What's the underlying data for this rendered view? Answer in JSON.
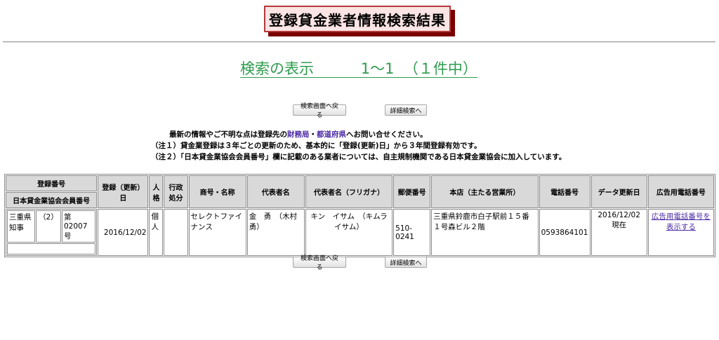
{
  "page": {
    "title": "登録貸金業者情報検索結果",
    "search_label": "検索の表示",
    "search_range": "1～1",
    "search_total": "（１件中）"
  },
  "buttons": {
    "back": "検索画面へ戻る",
    "detail": "詳細検索へ"
  },
  "notes": {
    "line1_prefix": "最新の情報やご不明な点は登録先の",
    "link1": "財務局",
    "sep": "・",
    "link2": "都道府県",
    "line1_suffix": "へお問い合せください。",
    "line2": "（注１）貸金業登録は３年ごとの更新のため、基本的に「登録(更新)日」から３年間登録有効です。",
    "line3": "（注２）「日本貸金業協会会員番号」欄に記載のある業者については、自主規制機関である日本貸金業協会に加入しています。"
  },
  "table": {
    "headers": {
      "reg_no": "登録番号",
      "assoc_no": "日本貸金業協会会員番号",
      "reg_date": "登録（更新）日",
      "person": "人格",
      "admin": "行政処分",
      "trade_name": "商号・名称",
      "rep": "代表者名",
      "rep_kana": "代表者名（フリガナ）",
      "postal": "郵便番号",
      "head_office": "本店（主たる営業所）",
      "phone": "電話番号",
      "updated": "データ更新日",
      "ad_phone": "広告用電話番号"
    },
    "row": {
      "authority": "三重県知事",
      "renewal": "（2）",
      "number": "第02007号",
      "assoc_no": "",
      "reg_date": "2016/12/02",
      "person": "個人",
      "admin": "",
      "trade_name": "セレクトファイナンス",
      "rep": "金　勇　（木村勇）",
      "rep_kana": "キン　イサム　（キムライサム）",
      "postal": "510-0241",
      "head_office": "三重県鈴鹿市白子駅前１５番１号森ビル２階",
      "phone": "0593864101",
      "updated": "2016/12/02 現在",
      "ad_phone_link": "広告用電話番号を表示する"
    }
  }
}
